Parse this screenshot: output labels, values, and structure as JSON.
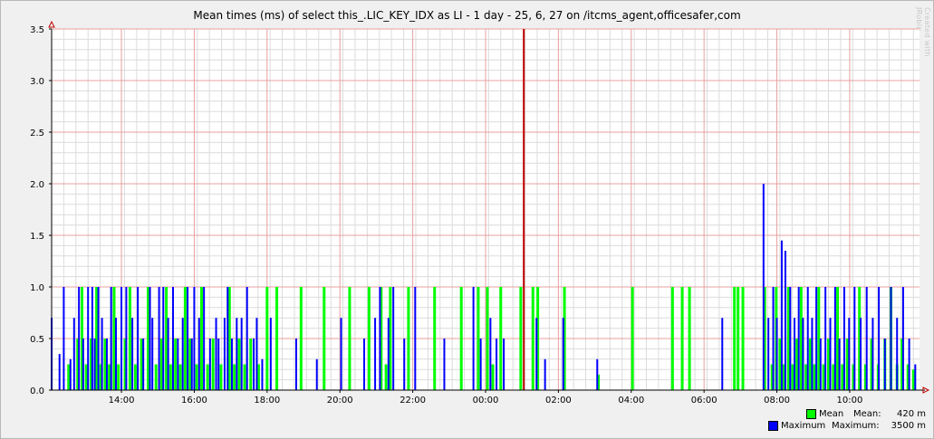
{
  "chart_data": {
    "type": "bar",
    "title": "Mean times (ms) of select this_.LIC_KEY_IDX as LI - 1 day - 25, 6, 27 on /itcms_agent,officesafer,com",
    "xlabel": "",
    "ylabel": "",
    "ylim": [
      0,
      3.5
    ],
    "xlim": [
      "12:05",
      "11:55"
    ],
    "yticks": [
      "0.0",
      "0.5",
      "1.0",
      "1.5",
      "2.0",
      "2.5",
      "3.0",
      "3.5"
    ],
    "xticks": [
      "14:00",
      "16:00",
      "18:00",
      "20:00",
      "22:00",
      "00:00",
      "02:00",
      "04:00",
      "06:00",
      "08:00",
      "10:00"
    ],
    "grid": true,
    "legend_position": "bottom-right",
    "series": [
      {
        "name": "Mean",
        "color": "#00ff00",
        "x": [
          "12:33",
          "12:48",
          "12:55",
          "13:02",
          "13:10",
          "13:19",
          "13:26",
          "13:33",
          "13:40",
          "13:48",
          "13:55",
          "14:06",
          "14:14",
          "14:23",
          "14:33",
          "14:44",
          "14:57",
          "15:06",
          "15:14",
          "15:21",
          "15:29",
          "15:37",
          "15:45",
          "15:53",
          "16:04",
          "16:12",
          "16:22",
          "16:31",
          "16:44",
          "16:58",
          "17:06",
          "17:14",
          "17:23",
          "17:33",
          "17:46",
          "18:00",
          "18:16",
          "18:56",
          "19:34",
          "20:16",
          "20:48",
          "21:08",
          "21:16",
          "21:23",
          "21:53",
          "22:36",
          "23:20",
          "23:48",
          "00:03",
          "00:12",
          "00:25",
          "00:58",
          "01:18",
          "01:26",
          "02:10",
          "03:06",
          "04:02",
          "05:08",
          "05:24",
          "05:36",
          "06:50",
          "06:56",
          "07:04",
          "07:40",
          "07:52",
          "07:59",
          "08:05",
          "08:12",
          "08:19",
          "08:26",
          "08:33",
          "08:40",
          "08:48",
          "08:55",
          "09:02",
          "09:09",
          "09:17",
          "09:25",
          "09:33",
          "09:40",
          "09:48",
          "09:56",
          "10:06",
          "10:16",
          "10:26",
          "10:36",
          "10:47",
          "10:58",
          "11:08",
          "11:18",
          "11:26",
          "11:36",
          "11:45"
        ],
        "values": [
          0.25,
          0.5,
          1.0,
          0.25,
          0.5,
          1.0,
          0.25,
          0.5,
          0.25,
          1.0,
          0.25,
          0.5,
          1.0,
          0.25,
          0.5,
          1.0,
          0.25,
          0.5,
          1.0,
          0.25,
          0.5,
          0.25,
          1.0,
          0.5,
          0.25,
          1.0,
          0.25,
          0.5,
          0.25,
          1.0,
          0.25,
          0.5,
          0.25,
          0.5,
          0.25,
          1.0,
          1.0,
          1.0,
          1.0,
          1.0,
          1.0,
          1.0,
          0.25,
          1.0,
          1.0,
          1.0,
          1.0,
          1.0,
          1.0,
          0.25,
          1.0,
          1.0,
          1.0,
          1.0,
          1.0,
          0.15,
          1.0,
          1.0,
          1.0,
          1.0,
          1.0,
          1.0,
          1.0,
          1.0,
          0.25,
          1.0,
          0.5,
          0.25,
          1.0,
          0.25,
          0.5,
          1.0,
          0.25,
          0.5,
          0.25,
          1.0,
          0.25,
          0.5,
          0.25,
          1.0,
          0.25,
          0.5,
          0.25,
          1.0,
          0.25,
          0.5,
          0.25,
          0.5,
          1.0,
          0.25,
          0.5,
          0.25,
          0.2
        ]
      },
      {
        "name": "Maximum",
        "color": "#0000ff",
        "x": [
          "12:05",
          "12:18",
          "12:25",
          "12:36",
          "12:42",
          "12:50",
          "12:57",
          "13:05",
          "13:12",
          "13:16",
          "13:22",
          "13:28",
          "13:36",
          "13:43",
          "13:51",
          "14:00",
          "14:08",
          "14:18",
          "14:27",
          "14:36",
          "14:47",
          "14:51",
          "15:02",
          "15:09",
          "15:17",
          "15:25",
          "15:33",
          "15:41",
          "15:49",
          "15:56",
          "16:00",
          "16:08",
          "16:16",
          "16:26",
          "16:36",
          "16:40",
          "16:50",
          "16:55",
          "17:02",
          "17:10",
          "17:18",
          "17:27",
          "17:38",
          "17:43",
          "17:52",
          "18:06",
          "18:48",
          "19:22",
          "20:02",
          "20:40",
          "20:58",
          "21:06",
          "21:20",
          "21:28",
          "21:46",
          "22:04",
          "22:52",
          "23:40",
          "23:52",
          "00:08",
          "00:18",
          "00:30",
          "01:03",
          "01:24",
          "01:38",
          "02:08",
          "03:04",
          "06:30",
          "07:38",
          "07:46",
          "07:54",
          "08:00",
          "08:08",
          "08:14",
          "08:22",
          "08:29",
          "08:36",
          "08:43",
          "08:51",
          "08:58",
          "09:05",
          "09:12",
          "09:20",
          "09:28",
          "09:36",
          "09:43",
          "09:51",
          "09:59",
          "10:08",
          "10:18",
          "10:28",
          "10:38",
          "10:48",
          "10:58",
          "11:08",
          "11:18",
          "11:28",
          "11:38",
          "11:48"
        ],
        "values": [
          0.7,
          0.35,
          1.0,
          0.3,
          0.7,
          1.0,
          0.5,
          1.0,
          1.0,
          0.5,
          1.0,
          0.7,
          0.5,
          1.0,
          0.7,
          1.0,
          1.0,
          0.7,
          1.0,
          0.5,
          1.0,
          0.7,
          1.0,
          1.0,
          0.7,
          1.0,
          0.5,
          0.7,
          1.0,
          0.5,
          1.0,
          0.7,
          1.0,
          0.5,
          0.7,
          0.5,
          0.7,
          1.0,
          0.5,
          0.7,
          0.7,
          1.0,
          0.5,
          0.7,
          0.3,
          0.7,
          0.5,
          0.3,
          0.7,
          0.5,
          0.7,
          1.0,
          0.7,
          1.0,
          0.5,
          1.0,
          0.5,
          1.0,
          0.5,
          0.7,
          0.5,
          0.5,
          3.5,
          0.7,
          0.3,
          0.7,
          0.3,
          0.7,
          2.0,
          0.7,
          1.0,
          0.7,
          1.45,
          1.35,
          1.0,
          0.7,
          1.0,
          0.7,
          1.0,
          0.7,
          1.0,
          0.5,
          1.0,
          0.7,
          1.0,
          0.5,
          1.0,
          0.7,
          1.0,
          0.7,
          1.0,
          0.7,
          1.0,
          0.5,
          1.0,
          0.7,
          1.0,
          0.5,
          0.25
        ]
      }
    ],
    "legend": {
      "mean_label": "Mean",
      "mean_stat_label": "Mean:",
      "mean_stat_value": "420 m",
      "max_label": "Maximum",
      "max_stat_label": "Maximum:",
      "max_stat_value": "3500 m"
    },
    "colors": {
      "background": "#f0f0f0",
      "major_grid": "#e8a0a0",
      "minor_grid": "#dcdcdc",
      "marker_line": "#c00000"
    }
  },
  "watermark": "Created with JRobin"
}
